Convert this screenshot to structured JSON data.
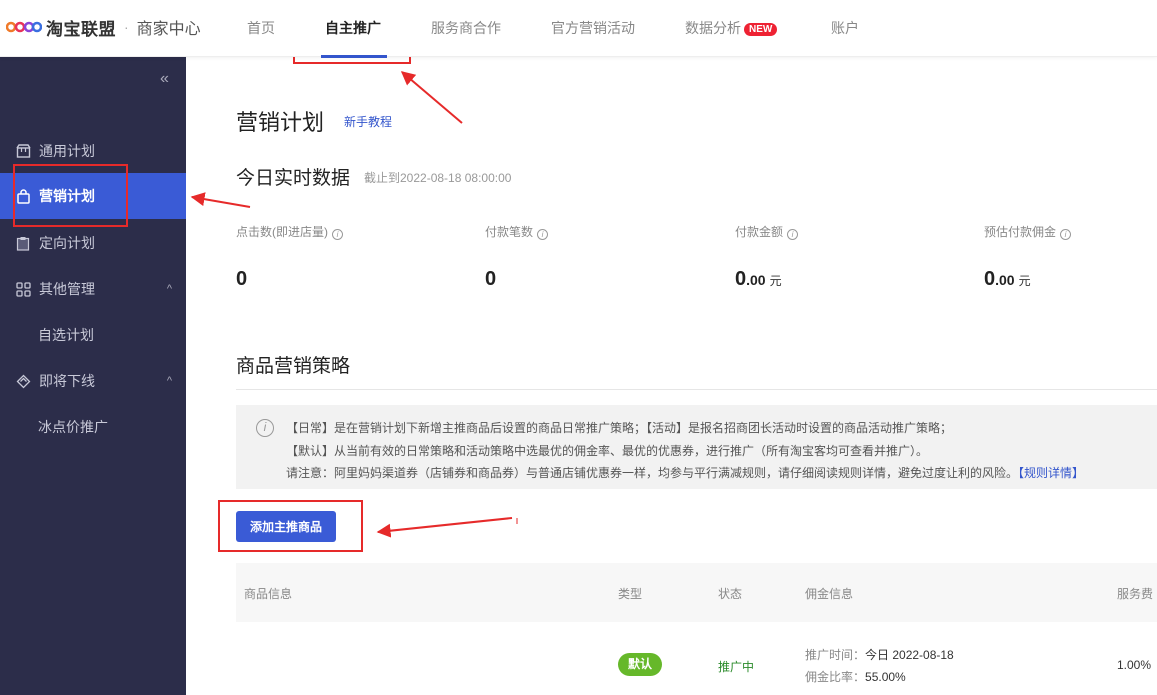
{
  "header": {
    "brand": "淘宝联盟",
    "separator": "·",
    "sub": "商家中心",
    "nav": [
      {
        "label": "首页"
      },
      {
        "label": "自主推广",
        "active": true
      },
      {
        "label": "服务商合作"
      },
      {
        "label": "官方营销活动"
      },
      {
        "label": "数据分析",
        "badge": "NEW"
      },
      {
        "label": "账户"
      }
    ]
  },
  "sidebar": {
    "collapse_icon": "«",
    "items": [
      {
        "label": "通用计划",
        "icon": "shop-icon"
      },
      {
        "label": "营销计划",
        "icon": "bag-icon",
        "active": true
      },
      {
        "label": "定向计划",
        "icon": "clipboard-icon"
      },
      {
        "label": "其他管理",
        "icon": "grid-icon",
        "chevron": "^"
      },
      {
        "label": "自选计划"
      },
      {
        "label": "即将下线",
        "icon": "tag-icon",
        "chevron": "^"
      },
      {
        "label": "冰点价推广"
      }
    ]
  },
  "main": {
    "title": "营销计划",
    "tutorial": "新手教程",
    "realtime_title": "今日实时数据",
    "cutoff": "截止到2022-08-18 08:00:00",
    "metrics": [
      {
        "label": "点击数(即进店量)",
        "int": "0",
        "dec": "",
        "unit": ""
      },
      {
        "label": "付款笔数",
        "int": "0",
        "dec": "",
        "unit": ""
      },
      {
        "label": "付款金额",
        "int": "0",
        "dec": ".00",
        "unit": "元"
      },
      {
        "label": "预估付款佣金",
        "int": "0",
        "dec": ".00",
        "unit": "元"
      }
    ],
    "strategy_title": "商品营销策略",
    "notice": [
      "【日常】是在营销计划下新增主推商品后设置的商品日常推广策略；【活动】是报名招商团长活动时设置的商品活动推广策略；",
      "【默认】从当前有效的日常策略和活动策略中选最优的佣金率、最优的优惠券，进行推广（所有淘宝客均可查看并推广）。",
      "请注意：阿里妈妈渠道券（店铺券和商品券）与普通店铺优惠券一样，均参与平行满减规则，请仔细阅读规则详情，避免过度让利的风险。"
    ],
    "notice_link": "【规则详情】",
    "add_button": "添加主推商品",
    "table": {
      "headers": [
        "商品信息",
        "类型",
        "状态",
        "佣金信息",
        "服务费"
      ],
      "rows": [
        {
          "type": "默认",
          "status": "推广中",
          "time_label": "推广时间：",
          "time_value": "今日 2022-08-18",
          "rate_label": "佣金比率：",
          "rate_value": "55.00%",
          "fee": "1.00%"
        }
      ]
    }
  },
  "colors": {
    "sidebar_bg": "#2c2d4a",
    "accent": "#3a5bd6",
    "annotation_red": "#e62a2a",
    "badge_red": "#ee2233",
    "tag_green": "#66b82a"
  }
}
